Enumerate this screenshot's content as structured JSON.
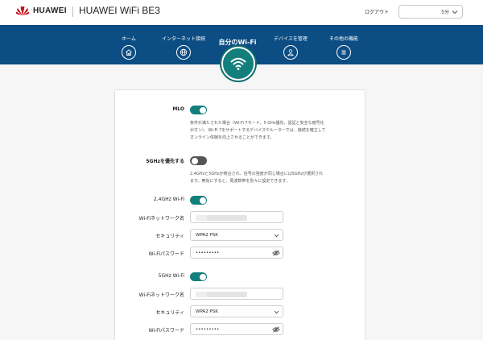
{
  "header": {
    "brand": "HUAWEI",
    "product": "HUAWEI WiFi BE3",
    "logout_label": "ログアウト",
    "logout_timeout": "5分"
  },
  "nav": {
    "items": [
      {
        "label": "ホーム",
        "icon": "home-icon"
      },
      {
        "label": "インターネット接続",
        "icon": "globe-icon"
      },
      {
        "label": "デバイスを管理",
        "icon": "user-icon"
      },
      {
        "label": "その他の機能",
        "icon": "menu-icon"
      }
    ],
    "active": {
      "label": "自分のWi-Fi",
      "icon": "wifi-icon"
    }
  },
  "settings": {
    "mlo": {
      "label": "MLO",
      "enabled": true,
      "description": "条件が満たされた場合（Wi-Fi 7モード、5 GHz優先、認証と安全な暗号化がオン）、Wi-Fi 7をサポートするデバイスやルーターでは、接続を確立してオンライン体験を向上させることができます。"
    },
    "prefer5g": {
      "label": "5GHzを優先する",
      "enabled": false,
      "description": "2.4GHzと5GHzが統合され、信号の強度が同じ場合には5GHzが選択されます。無効にすると、周波数帯を別々に設定できます。"
    },
    "band24": {
      "label": "2.4GHz Wi-Fi",
      "enabled": true,
      "ssid_label": "Wi-Fiネットワーク名",
      "security_label": "セキュリティ",
      "security_value": "WPA2 PSK",
      "password_label": "Wi-Fiパスワード",
      "password_value": "•••••••••"
    },
    "band5": {
      "label": "5GHz Wi-Fi",
      "enabled": true,
      "ssid_label": "Wi-Fiネットワーク名",
      "security_label": "セキュリティ",
      "security_value": "WPA2 PSK",
      "password_label": "Wi-Fiパスワード",
      "password_value": "•••••••••"
    }
  },
  "colors": {
    "nav_background": "#0c4d83",
    "accent_teal": "#137f7d",
    "brand_red": "#c7000b"
  }
}
